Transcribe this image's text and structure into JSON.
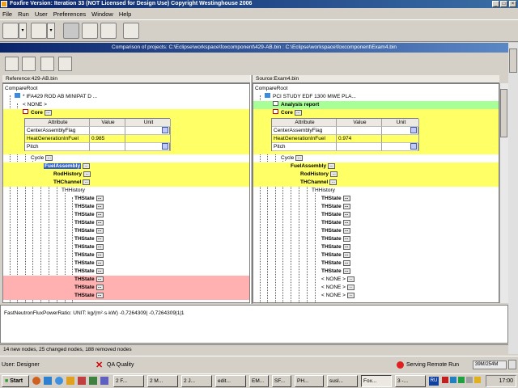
{
  "window": {
    "title": "Foxfire Version: Iteration 33 (NOT Licensed for Design Use)    Copyright Westinghouse 2006"
  },
  "menu": [
    "File",
    "Run",
    "User",
    "Preferences",
    "Window",
    "Help"
  ],
  "comparison": {
    "title": "Comparison of projects: C:\\Eclipse\\workspace\\foxcomponent\\429-AB.bin : C:\\Eclipse\\workspace\\foxcomponent\\Exam4.bin"
  },
  "left": {
    "header": "Reference:429-AB.bin",
    "root": "CompareRoot",
    "project": "* IFA429 ROD AB MINIPAT D ...",
    "none": "< NONE >",
    "core": "Core",
    "table_headers": [
      "Attribute",
      "Value",
      "Unit"
    ],
    "table_rows": [
      {
        "attr": "CenterAssemblyFlag",
        "value": "",
        "unit": ""
      },
      {
        "attr": "HeatGenerationInFuel",
        "value": "0.985",
        "unit": ""
      },
      {
        "attr": "Pitch",
        "value": "",
        "unit": ""
      }
    ],
    "cycle": "Cycle",
    "fuel": "FuelAssembly",
    "rod": "RodHistory",
    "thchannel": "THChannel",
    "thhistory": "THHistory",
    "thstates": [
      "THState",
      "THState",
      "THState",
      "THState",
      "THState",
      "THState",
      "THState",
      "THState",
      "THState",
      "THState",
      "THState",
      "THState",
      "THState"
    ]
  },
  "right": {
    "header": "Source:Exam4.bin",
    "root": "CompareRoot",
    "project": "PCI STUDY EDF 1300 MWE PLA...",
    "analysis": "Analysis report",
    "core": "Core",
    "table_headers": [
      "Attribute",
      "Value",
      "Unit"
    ],
    "table_rows": [
      {
        "attr": "CenterAssemblyFlag",
        "value": "",
        "unit": ""
      },
      {
        "attr": "HeatGenerationInFuel",
        "value": "0.974",
        "unit": ""
      },
      {
        "attr": "Pitch",
        "value": "",
        "unit": ""
      }
    ],
    "cycle": "Cycle",
    "fuel": "FuelAssembly",
    "rod": "RodHistory",
    "thchannel": "THChannel",
    "thhistory": "THHistory",
    "items": [
      "THState",
      "THState",
      "THState",
      "THState",
      "THState",
      "THState",
      "THState",
      "THState",
      "THState",
      "THState",
      "< NONE >",
      "< NONE >",
      "< NONE >"
    ]
  },
  "detail": "FastNeutronFluxPowerRatio: UNIT: kg/(m²·s·kW)   -0,7264309|  -0,7264309|1|1",
  "summary": "14 new nodes, 25 changed nodes, 188 removed nodes",
  "status": {
    "user": "User: Designer",
    "qa": "QA Quality",
    "serving": "Serving Remote Run",
    "memory": "39M/254M"
  },
  "taskbar": {
    "start": "Start",
    "items": [
      "2 F...",
      "2 M...",
      "2 J...",
      "edit...",
      "EM...",
      "SF...",
      "PH...",
      "susl...",
      "Fox...",
      "3 -..."
    ],
    "lang": "RU",
    "clock": "17:00"
  },
  "colors": {
    "changed": "#ffff66",
    "new": "#a8ff98",
    "removed": "#ffb0b0",
    "title": "#0a246a"
  }
}
